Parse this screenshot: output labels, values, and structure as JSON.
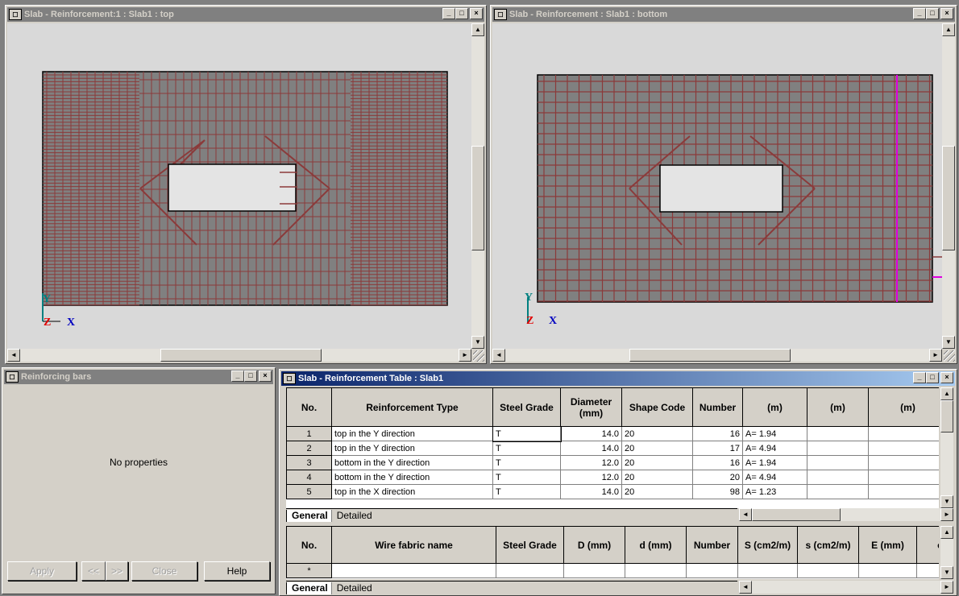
{
  "windows": {
    "top_view": {
      "title": "Slab - Reinforcement:1 : Slab1  : top"
    },
    "bottom_view": {
      "title": "Slab - Reinforcement : Slab1  : bottom"
    },
    "props": {
      "title": "Reinforcing bars",
      "empty_text": "No properties",
      "buttons": {
        "apply": "Apply",
        "prev": "<<",
        "next": ">>",
        "close": "Close",
        "help": "Help"
      }
    },
    "table": {
      "title": "Slab - Reinforcement Table : Slab1"
    }
  },
  "title_buttons": {
    "min": "_",
    "max": "□",
    "close": "×"
  },
  "axes": {
    "y": "Y",
    "z": "Z",
    "x": "X"
  },
  "scroll": {
    "up": "▲",
    "down": "▼",
    "left": "◄",
    "right": "►"
  },
  "bars_table": {
    "headers": [
      "No.",
      "Reinforcement Type",
      "Steel Grade",
      "Diameter (mm)",
      "Shape Code",
      "Number",
      "(m)",
      "(m)",
      "(m)"
    ],
    "rows": [
      {
        "no": "1",
        "type": "top in the Y direction",
        "grade": "T",
        "dia": "14.0",
        "shape": "20",
        "number": "16",
        "len": "A= 1.94"
      },
      {
        "no": "2",
        "type": "top in the Y direction",
        "grade": "T",
        "dia": "14.0",
        "shape": "20",
        "number": "17",
        "len": "A= 4.94"
      },
      {
        "no": "3",
        "type": "bottom in the Y direction",
        "grade": "T",
        "dia": "12.0",
        "shape": "20",
        "number": "16",
        "len": "A= 1.94"
      },
      {
        "no": "4",
        "type": "bottom in the Y direction",
        "grade": "T",
        "dia": "12.0",
        "shape": "20",
        "number": "20",
        "len": "A= 4.94"
      },
      {
        "no": "5",
        "type": "top in the X direction",
        "grade": "T",
        "dia": "14.0",
        "shape": "20",
        "number": "98",
        "len": "A= 1.23"
      }
    ]
  },
  "fabric_table": {
    "headers": [
      "No.",
      "Wire fabric name",
      "Steel Grade",
      "D (mm)",
      "d (mm)",
      "Number",
      "S (cm2/m)",
      "s (cm2/m)",
      "E (mm)",
      "e"
    ],
    "new_row_marker": "*"
  },
  "tabs": {
    "general": "General",
    "detailed": "Detailed"
  },
  "colors": {
    "rebar": "#8b3a3a",
    "slab": "#808080",
    "magenta": "#e000e0"
  }
}
